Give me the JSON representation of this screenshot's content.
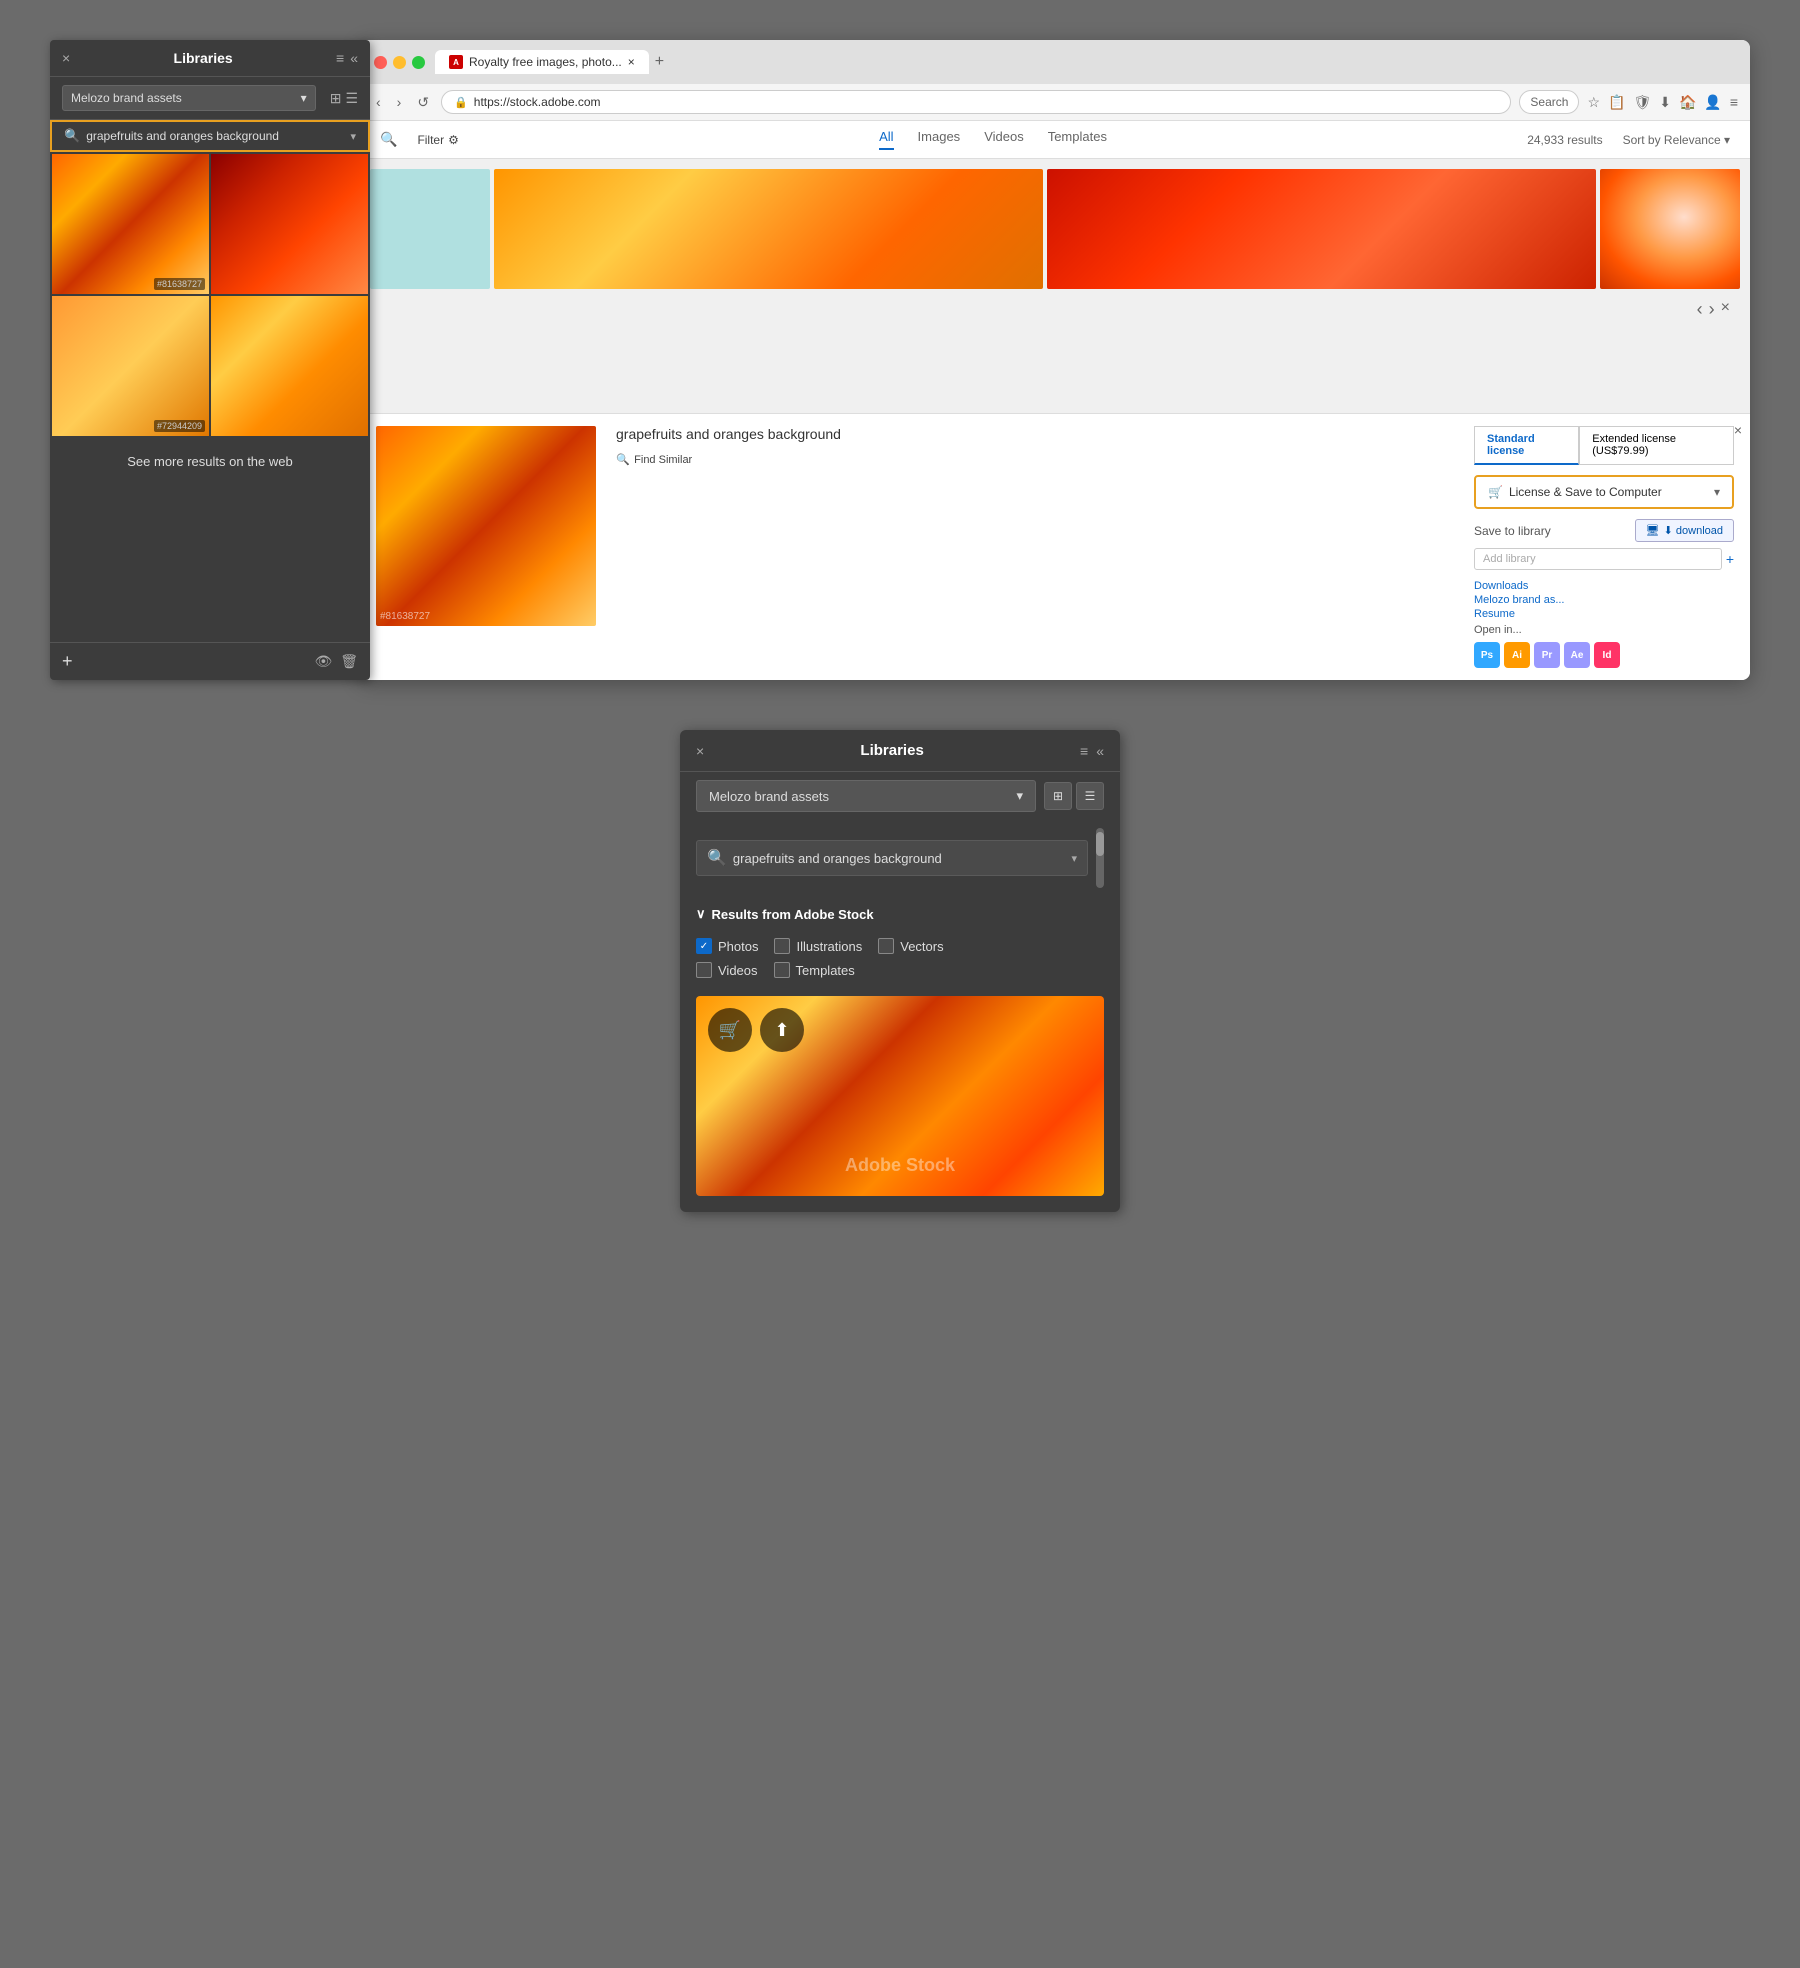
{
  "top": {
    "libraries_panel": {
      "title": "Libraries",
      "close_label": "×",
      "collapse_label": "«",
      "menu_label": "≡",
      "library_name": "Melozo brand assets",
      "search_query": "grapefruits and oranges background",
      "image1_id": "#81638727",
      "image2_id": "#72944209",
      "see_more_label": "See more results on the web",
      "add_label": "+",
      "view_grid": "⊞",
      "view_list": "☰"
    },
    "browser": {
      "tab_title": "Royalty free images, photo...",
      "tab_close": "×",
      "new_tab": "+",
      "url": "https://stock.adobe.com",
      "search_placeholder": "Search",
      "nav_back": "‹",
      "nav_forward": "›",
      "reload": "↺",
      "filter_label": "Filter",
      "tabs": [
        "All",
        "Images",
        "Videos",
        "Templates"
      ],
      "active_tab": "All",
      "results_count": "24,933 results",
      "sort_label": "Sort by Relevance",
      "image_title": "grapefruits and oranges background",
      "image_id": "#81638727",
      "license_tabs": [
        "Standard license",
        "Extended license (US$79.99)"
      ],
      "license_btn": "License & Save to  Computer",
      "save_library_label": "Save to library",
      "download_btn": "⬇ download",
      "add_library_placeholder": "Add library",
      "open_in_label": "Open in...",
      "downloads_link": "Downloads",
      "melozo_link": "Melozo brand as...",
      "resume_link": "Resume",
      "find_similar": "Find Similar"
    }
  },
  "bottom": {
    "libraries_panel": {
      "title": "Libraries",
      "close_label": "×",
      "collapse_label": "«",
      "menu_label": "≡",
      "library_name": "Melozo brand assets",
      "search_query": "grapefruits and oranges background",
      "results_header": "Results from Adobe Stock",
      "checkboxes": {
        "photos": {
          "label": "Photos",
          "checked": true
        },
        "illustrations": {
          "label": "Illustrations",
          "checked": false
        },
        "vectors": {
          "label": "Vectors",
          "checked": false
        },
        "videos": {
          "label": "Videos",
          "checked": false
        },
        "templates": {
          "label": "Templates",
          "checked": false
        }
      },
      "watermark": "Adobe Stock",
      "image_title": "grapefruits and oranges background"
    }
  }
}
